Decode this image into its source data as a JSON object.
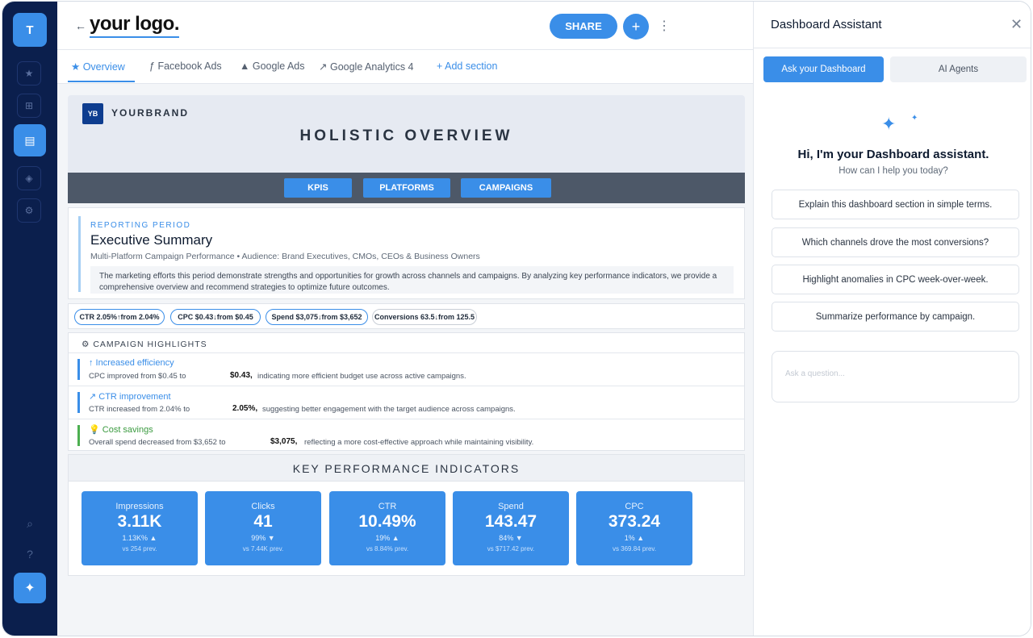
{
  "rail": {
    "avatar": "T",
    "icons": [
      "star-icon",
      "grid-icon",
      "dashboard-icon",
      "tag-icon",
      "gear-icon",
      "search-icon",
      "help-icon",
      "sparkle-icon"
    ]
  },
  "header": {
    "back": "←",
    "logo": "your logo.",
    "share_label": "SHARE",
    "add_label": "+",
    "more_label": "⋮"
  },
  "tabs": [
    {
      "icon": "★",
      "label": "Overview"
    },
    {
      "icon": "ƒ",
      "label": "Facebook Ads"
    },
    {
      "icon": "▲",
      "label": "Google Ads"
    },
    {
      "icon": "↗",
      "label": "Google Analytics 4"
    },
    {
      "icon": "+",
      "label": "Add section"
    }
  ],
  "hero": {
    "badge": "YB",
    "brand": "YOURBRAND",
    "title": "HOLISTIC OVERVIEW",
    "nav": [
      "KPIS",
      "PLATFORMS",
      "CAMPAIGNS"
    ]
  },
  "summary": {
    "period_label": "REPORTING PERIOD",
    "title": "Executive Summary",
    "subtitle": "Multi-Platform Campaign Performance • Audience: Brand Executives, CMOs, CEOs & Business Owners",
    "body": "The marketing efforts this period demonstrate strengths and opportunities for growth across channels and campaigns. By analyzing key performance indicators, we provide a comprehensive overview and recommend strategies to optimize future outcomes."
  },
  "pills": [
    "CTR 2.05%↑from 2.04%",
    "CPC $0.43↓from $0.45",
    "Spend $3,075↓from $3,652",
    "Conversions 63.5↓from 125.5"
  ],
  "highlights": {
    "heading": "CAMPAIGN HIGHLIGHTS",
    "rows": [
      {
        "title": "↑ Increased efficiency",
        "text": "CPC improved from $0.45 to",
        "value": "$0.43,",
        "tail": "indicating more efficient budget use across active campaigns.",
        "color": "#3a8ee8"
      },
      {
        "title": "↗ CTR improvement",
        "text": "CTR increased from 2.04% to",
        "value": "2.05%,",
        "tail": "suggesting better engagement with the target audience across campaigns.",
        "color": "#3a8ee8"
      },
      {
        "title": "💡 Cost savings",
        "text": "Overall spend decreased from $3,652 to",
        "value": "$3,075,",
        "tail": "reflecting a more cost-effective approach while maintaining visibility.",
        "color": "#4caf50"
      }
    ]
  },
  "kpis": {
    "heading": "KEY PERFORMANCE INDICATORS",
    "cards": [
      {
        "label": "Impressions",
        "value": "3.11K",
        "delta": "1.13K% ▲",
        "prev": "vs 254 prev."
      },
      {
        "label": "Clicks",
        "value": "41",
        "delta": "99% ▼",
        "prev": "vs 7.44K prev."
      },
      {
        "label": "CTR",
        "value": "10.49%",
        "delta": "19% ▲",
        "prev": "vs 8.84% prev."
      },
      {
        "label": "Spend",
        "value": "143.47",
        "delta": "84% ▼",
        "prev": "vs $717.42 prev."
      },
      {
        "label": "CPC",
        "value": "373.24",
        "delta": "1% ▲",
        "prev": "vs 369.84 prev."
      }
    ]
  },
  "assistant": {
    "title": "Dashboard Assistant",
    "close": "✕",
    "tab_ask": "Ask your Dashboard",
    "tab_agents": "AI Agents",
    "greeting": "Hi, I'm your Dashboard assistant.",
    "subgreeting": "How can I help you today?",
    "suggestions": [
      "Explain this dashboard section in simple terms.",
      "Which channels drove the most conversions?",
      "Highlight anomalies in CPC week-over-week.",
      "Summarize performance by campaign."
    ],
    "input_placeholder": "Ask a question..."
  },
  "colors": {
    "rail": "#0b1f4d",
    "accent": "#3a8ee8",
    "nav_band": "#4d5868",
    "success": "#4caf50"
  }
}
